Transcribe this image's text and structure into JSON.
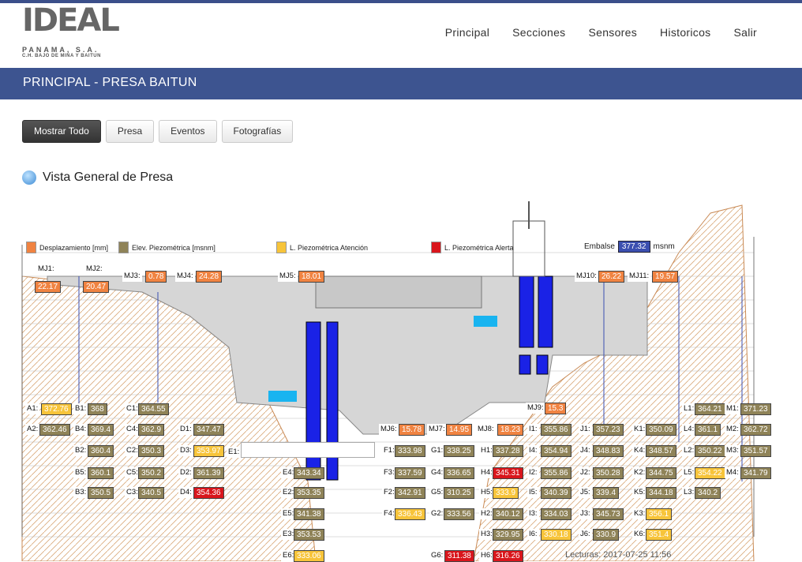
{
  "logo": {
    "brand": "IDEAL",
    "company": "PANAMA, S.A.",
    "plant": "C.H. BAJO DE MINA Y BAITUN"
  },
  "nav": [
    "Principal",
    "Secciones",
    "Sensores",
    "Historicos",
    "Salir"
  ],
  "title": "PRINCIPAL - PRESA BAITUN",
  "buttons": [
    "Mostrar Todo",
    "Presa",
    "Eventos",
    "Fotografías"
  ],
  "section": "Vista General de Presa",
  "legend": {
    "desplazamiento": "Desplazamiento [mm]",
    "elev": "Elev. Piezométrica [msnm]",
    "atencion": "L. Piezométrica Atención",
    "alerta": "L. Piezométrica Alerta",
    "embalse_label": "Embalse",
    "embalse_value": "377.32",
    "embalse_unit": "msnm"
  },
  "colors": {
    "piezo": "#8f8358",
    "desp": "#f08341",
    "atencion": "#f7c43a",
    "alerta": "#d9161c",
    "embalse": "#3b4fb0"
  },
  "sensors": [
    {
      "id": "MJ1:",
      "val": "22.17",
      "t": "d"
    },
    {
      "id": "MJ2:",
      "val": "20.47",
      "t": "d"
    },
    {
      "id": "MJ3:",
      "val": "0.78",
      "t": "d"
    },
    {
      "id": "MJ4:",
      "val": "24.28",
      "t": "d"
    },
    {
      "id": "MJ5:",
      "val": "18.01",
      "t": "d"
    },
    {
      "id": "MJ10:",
      "val": "26.22",
      "t": "d"
    },
    {
      "id": "MJ11:",
      "val": "19.57",
      "t": "d"
    },
    {
      "id": "MJ9:",
      "val": "15.3",
      "t": "d"
    },
    {
      "id": "MJ6:",
      "val": "15.78",
      "t": "d"
    },
    {
      "id": "MJ7:",
      "val": "14.95",
      "t": "d"
    },
    {
      "id": "MJ8:",
      "val": "18.23",
      "t": "d"
    },
    {
      "id": "A1:",
      "val": "372.76",
      "t": "y"
    },
    {
      "id": "A2:",
      "val": "362.46",
      "t": "p"
    },
    {
      "id": "B1:",
      "val": "368",
      "t": "p"
    },
    {
      "id": "B4:",
      "val": "369.4",
      "t": "p"
    },
    {
      "id": "B2:",
      "val": "360.4",
      "t": "p"
    },
    {
      "id": "B5:",
      "val": "360.1",
      "t": "p"
    },
    {
      "id": "B3:",
      "val": "350.5",
      "t": "p"
    },
    {
      "id": "C1:",
      "val": "364.55",
      "t": "p"
    },
    {
      "id": "C4:",
      "val": "362.9",
      "t": "p"
    },
    {
      "id": "C2:",
      "val": "350.3",
      "t": "p"
    },
    {
      "id": "C5:",
      "val": "350.2",
      "t": "p"
    },
    {
      "id": "C3:",
      "val": "340.5",
      "t": "p"
    },
    {
      "id": "D1:",
      "val": "347.47",
      "t": "p"
    },
    {
      "id": "D3:",
      "val": "353.97",
      "t": "y"
    },
    {
      "id": "D2:",
      "val": "361.39",
      "t": "p"
    },
    {
      "id": "D4:",
      "val": "354.36",
      "t": "r"
    },
    {
      "id": "E1:",
      "val": "",
      "t": "input"
    },
    {
      "id": "E4:",
      "val": "343.34",
      "t": "p"
    },
    {
      "id": "E2:",
      "val": "353.35",
      "t": "p"
    },
    {
      "id": "E5:",
      "val": "341.38",
      "t": "p"
    },
    {
      "id": "E3:",
      "val": "353.53",
      "t": "p"
    },
    {
      "id": "E6:",
      "val": "333.06",
      "t": "y"
    },
    {
      "id": "F1:",
      "val": "333.98",
      "t": "p"
    },
    {
      "id": "F3:",
      "val": "337.59",
      "t": "p"
    },
    {
      "id": "F2:",
      "val": "342.91",
      "t": "p"
    },
    {
      "id": "F4:",
      "val": "336.43",
      "t": "y"
    },
    {
      "id": "G1:",
      "val": "338.25",
      "t": "p"
    },
    {
      "id": "G4:",
      "val": "336.65",
      "t": "p"
    },
    {
      "id": "G5:",
      "val": "310.25",
      "t": "p"
    },
    {
      "id": "G2:",
      "val": "333.56",
      "t": "p"
    },
    {
      "id": "G6:",
      "val": "311.38",
      "t": "r"
    },
    {
      "id": "H1:",
      "val": "337.28",
      "t": "p"
    },
    {
      "id": "H4:",
      "val": "345.31",
      "t": "r"
    },
    {
      "id": "H5:",
      "val": "333.9",
      "t": "y"
    },
    {
      "id": "H2:",
      "val": "340.12",
      "t": "p"
    },
    {
      "id": "H3:",
      "val": "329.95",
      "t": "p"
    },
    {
      "id": "H6:",
      "val": "316.26",
      "t": "r"
    },
    {
      "id": "I1:",
      "val": "355.86",
      "t": "p"
    },
    {
      "id": "I4:",
      "val": "354.94",
      "t": "p"
    },
    {
      "id": "I2:",
      "val": "355.86",
      "t": "p"
    },
    {
      "id": "I5:",
      "val": "340.39",
      "t": "p"
    },
    {
      "id": "I3:",
      "val": "334.03",
      "t": "p"
    },
    {
      "id": "I6:",
      "val": "330.18",
      "t": "y"
    },
    {
      "id": "J1:",
      "val": "357.23",
      "t": "p"
    },
    {
      "id": "J4:",
      "val": "348.83",
      "t": "p"
    },
    {
      "id": "J2:",
      "val": "350.28",
      "t": "p"
    },
    {
      "id": "J5:",
      "val": "339.4",
      "t": "p"
    },
    {
      "id": "J3:",
      "val": "345.73",
      "t": "p"
    },
    {
      "id": "J6:",
      "val": "330.9",
      "t": "p"
    },
    {
      "id": "K1:",
      "val": "350.09",
      "t": "p"
    },
    {
      "id": "K4:",
      "val": "348.57",
      "t": "p"
    },
    {
      "id": "K2:",
      "val": "344.75",
      "t": "p"
    },
    {
      "id": "K5:",
      "val": "344.18",
      "t": "p"
    },
    {
      "id": "K3:",
      "val": "356.1",
      "t": "y"
    },
    {
      "id": "K6:",
      "val": "351.4",
      "t": "y"
    },
    {
      "id": "L1:",
      "val": "364.21",
      "t": "p"
    },
    {
      "id": "L4:",
      "val": "361.1",
      "t": "p"
    },
    {
      "id": "L2:",
      "val": "350.22",
      "t": "p"
    },
    {
      "id": "L5:",
      "val": "354.22",
      "t": "y"
    },
    {
      "id": "L3:",
      "val": "340.2",
      "t": "p"
    },
    {
      "id": "M1:",
      "val": "371.23",
      "t": "p"
    },
    {
      "id": "M2:",
      "val": "362.72",
      "t": "p"
    },
    {
      "id": "M3:",
      "val": "351.57",
      "t": "p"
    },
    {
      "id": "M4:",
      "val": "341.79",
      "t": "p"
    }
  ],
  "lecturas": "Lecturas: 2017-07-25 11:56"
}
